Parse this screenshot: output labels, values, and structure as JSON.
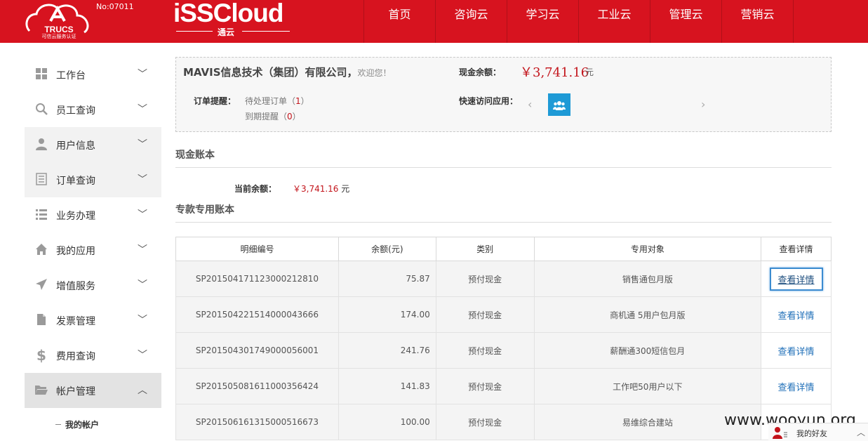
{
  "header": {
    "trucs_label": "TRUCS",
    "trucs_sub": "可信云服务认证",
    "trucs_no": "No:07011",
    "brand": "iSSCloud",
    "brand_sub": "通云",
    "nav": [
      "首页",
      "咨询云",
      "学习云",
      "工业云",
      "管理云",
      "营销云"
    ]
  },
  "sidebar": {
    "items": [
      {
        "label": "工作台",
        "icon": "dashboard-icon"
      },
      {
        "label": "员工查询",
        "icon": "search-icon"
      },
      {
        "label": "用户信息",
        "icon": "user-icon"
      },
      {
        "label": "订单查询",
        "icon": "order-icon"
      },
      {
        "label": "业务办理",
        "icon": "list-icon"
      },
      {
        "label": "我的应用",
        "icon": "home-icon"
      },
      {
        "label": "增值服务",
        "icon": "send-icon"
      },
      {
        "label": "发票管理",
        "icon": "file-icon"
      },
      {
        "label": "费用查询",
        "icon": "dollar-icon"
      },
      {
        "label": "帐户管理",
        "icon": "folder-icon"
      }
    ],
    "sub_item": "我的帐户"
  },
  "summary": {
    "company": "MAVIS信息技术（集团）有限公司，",
    "welcome": "欢迎您！",
    "cash_label": "现金余额：",
    "cash_value": "￥3,741.16",
    "cash_unit": "元",
    "order_label": "订单提醒：",
    "pending_prefix": "待处理订单（",
    "pending_count": "1",
    "expire_prefix": "到期提醒（",
    "expire_count": "0",
    "close_paren": "）",
    "quick_label": "快速访问应用："
  },
  "cash_book": {
    "title": "现金账本",
    "current_label": "当前余额：",
    "current_value": "￥3,741.16",
    "current_unit": "元"
  },
  "special_book": {
    "title": "专款专用账本",
    "headers": [
      "明细编号",
      "余额(元)",
      "类别",
      "专用对象",
      "查看详情"
    ],
    "rows": [
      {
        "id": "SP201504171123000212810",
        "amount": "75.87",
        "type": "预付现金",
        "target": "销售通包月版",
        "action": "查看详情"
      },
      {
        "id": "SP201504221514000043666",
        "amount": "174.00",
        "type": "预付现金",
        "target": "商机通 5用户包月版",
        "action": "查看详情"
      },
      {
        "id": "SP201504301749000056001",
        "amount": "241.76",
        "type": "预付现金",
        "target": "薪酬通300短信包月",
        "action": "查看详情"
      },
      {
        "id": "SP201505081611000356424",
        "amount": "141.83",
        "type": "预付现金",
        "target": "工作吧50用户以下",
        "action": "查看详情"
      },
      {
        "id": "SP201506161315000516673",
        "amount": "100.00",
        "type": "预付现金",
        "target": "易维综合建站",
        "action": ""
      }
    ]
  },
  "overlay": {
    "watermark": "www.wooyun.org",
    "friends": "我的好友"
  },
  "colors": {
    "header": "#d7131f",
    "accent_red": "#c3141b",
    "link": "#1f6fb8",
    "tile": "#1e9ad6"
  }
}
